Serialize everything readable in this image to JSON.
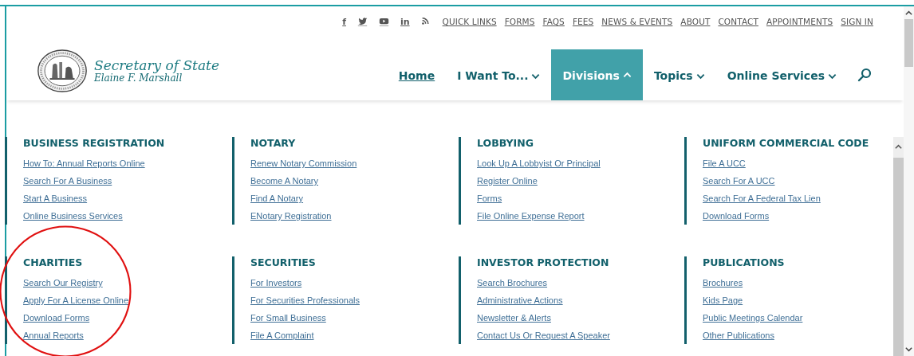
{
  "social": [
    {
      "kind": "letter",
      "label": "f"
    },
    {
      "kind": "bird"
    },
    {
      "kind": "play"
    },
    {
      "kind": "letter",
      "label": "in"
    },
    {
      "kind": "feed"
    }
  ],
  "utility_links": [
    "QUICK LINKS",
    "FORMS",
    "FAQS",
    "FEES",
    "NEWS & EVENTS",
    "ABOUT",
    "CONTACT",
    "APPOINTMENTS",
    "SIGN IN"
  ],
  "logo": {
    "title": "Secretary of State",
    "subtitle": "Elaine F. Marshall"
  },
  "nav": [
    {
      "label": "Home",
      "kind": "link",
      "selected": false
    },
    {
      "label": "I Want To...",
      "kind": "menu",
      "selected": false,
      "expanded": false
    },
    {
      "label": "Divisions",
      "kind": "menu",
      "selected": true,
      "expanded": true
    },
    {
      "label": "Topics",
      "kind": "menu",
      "selected": false,
      "expanded": false
    },
    {
      "label": "Online Services",
      "kind": "menu",
      "selected": false,
      "expanded": false
    }
  ],
  "sections": [
    {
      "title": "BUSINESS REGISTRATION",
      "links": [
        "How To: Annual Reports Online",
        "Search For A Business",
        "Start A Business",
        "Online Business Services"
      ]
    },
    {
      "title": "NOTARY",
      "links": [
        "Renew Notary Commission",
        "Become A Notary",
        "Find A Notary",
        "ENotary Registration"
      ]
    },
    {
      "title": "LOBBYING",
      "links": [
        "Look Up A Lobbyist Or Principal",
        "Register Online",
        "Forms",
        "File Online Expense Report"
      ]
    },
    {
      "title": "UNIFORM COMMERCIAL CODE",
      "links": [
        "File A UCC",
        "Search For A UCC",
        "Search For A Federal Tax Lien",
        "Download Forms"
      ]
    },
    {
      "title": "CHARITIES",
      "links": [
        "Search Our Registry",
        "Apply For A License Online",
        "Download Forms",
        "Annual Reports"
      ]
    },
    {
      "title": "SECURITIES",
      "links": [
        "For Investors",
        "For Securities Professionals",
        "For Small Business",
        "File A Complaint"
      ]
    },
    {
      "title": "INVESTOR PROTECTION",
      "links": [
        "Search Brochures",
        "Administrative Actions",
        "Newsletter & Alerts",
        "Contact Us Or Request A Speaker"
      ]
    },
    {
      "title": "PUBLICATIONS",
      "links": [
        "Brochures",
        "Kids Page",
        "Public Meetings Calendar",
        "Other Publications"
      ]
    }
  ],
  "annotation": {
    "kind": "ellipse"
  }
}
